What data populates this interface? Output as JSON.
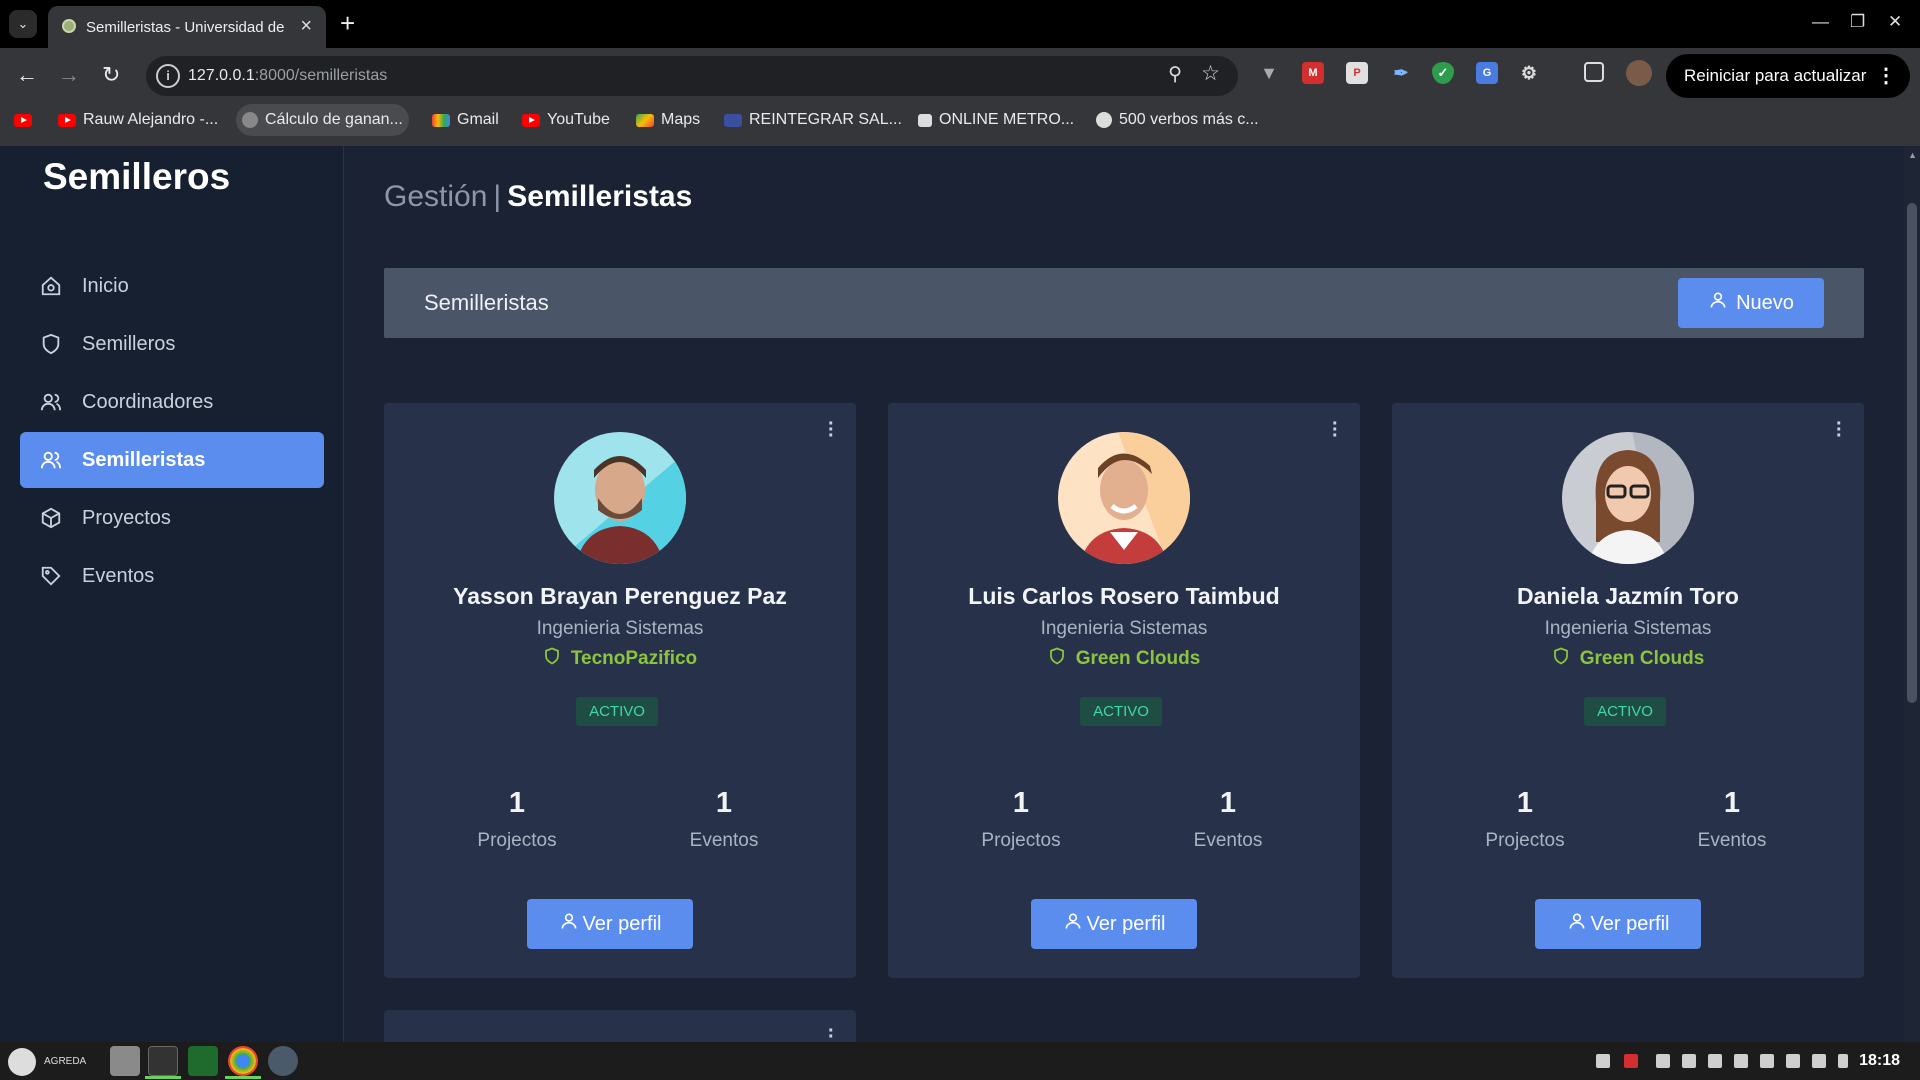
{
  "browser": {
    "tab_title": "Semilleristas - Universidad de",
    "url_host": "127.0.0.1",
    "url_path": ":8000/semilleristas",
    "restart_label": "Reiniciar para actualizar",
    "bookmarks": [
      {
        "label": "Rauw Alejandro -...",
        "icon": "youtube-icon"
      },
      {
        "label": "Cálculo de ganan...",
        "icon": "site-icon"
      },
      {
        "label": "Gmail",
        "icon": "gmail-icon"
      },
      {
        "label": "YouTube",
        "icon": "youtube-icon"
      },
      {
        "label": "Maps",
        "icon": "maps-icon"
      },
      {
        "label": "REINTEGRAR SAL...",
        "icon": "site-icon"
      },
      {
        "label": "ONLINE METRO...",
        "icon": "chart-icon"
      },
      {
        "label": "500 verbos más c...",
        "icon": "globe-icon"
      }
    ]
  },
  "sidebar": {
    "brand": "Semilleros",
    "items": [
      {
        "label": "Inicio",
        "icon": "home-icon"
      },
      {
        "label": "Semilleros",
        "icon": "shield-icon"
      },
      {
        "label": "Coordinadores",
        "icon": "users-icon"
      },
      {
        "label": "Semilleristas",
        "icon": "users-icon",
        "active": true
      },
      {
        "label": "Proyectos",
        "icon": "box-icon"
      },
      {
        "label": "Eventos",
        "icon": "tag-icon"
      }
    ]
  },
  "main": {
    "breadcrumb_section": "Gestión",
    "breadcrumb_separator": "|",
    "breadcrumb_page": "Semilleristas",
    "header_title": "Semilleristas",
    "new_button": "Nuevo",
    "cards": [
      {
        "name": "Yasson Brayan Perenguez Paz",
        "career": "Ingenieria Sistemas",
        "group": "TecnoPazifico",
        "status": "ACTIVO",
        "projects": "1",
        "projects_label": "Projectos",
        "events": "1",
        "events_label": "Eventos",
        "button": "Ver perfil"
      },
      {
        "name": "Luis Carlos Rosero Taimbud",
        "career": "Ingenieria Sistemas",
        "group": "Green Clouds",
        "status": "ACTIVO",
        "projects": "1",
        "projects_label": "Projectos",
        "events": "1",
        "events_label": "Eventos",
        "button": "Ver perfil"
      },
      {
        "name": "Daniela Jazmín Toro",
        "career": "Ingenieria Sistemas",
        "group": "Green Clouds",
        "status": "ACTIVO",
        "projects": "1",
        "projects_label": "Projectos",
        "events": "1",
        "events_label": "Eventos",
        "button": "Ver perfil"
      }
    ]
  },
  "taskbar": {
    "user_label": "AGREDA",
    "clock": "18:18"
  },
  "colors": {
    "accent": "#5b8def",
    "group_green": "#8cc43f",
    "status_text": "#3dd9a8",
    "status_bg": "#1f4d43",
    "card_bg": "#27324a",
    "page_bg": "#1a2233"
  }
}
